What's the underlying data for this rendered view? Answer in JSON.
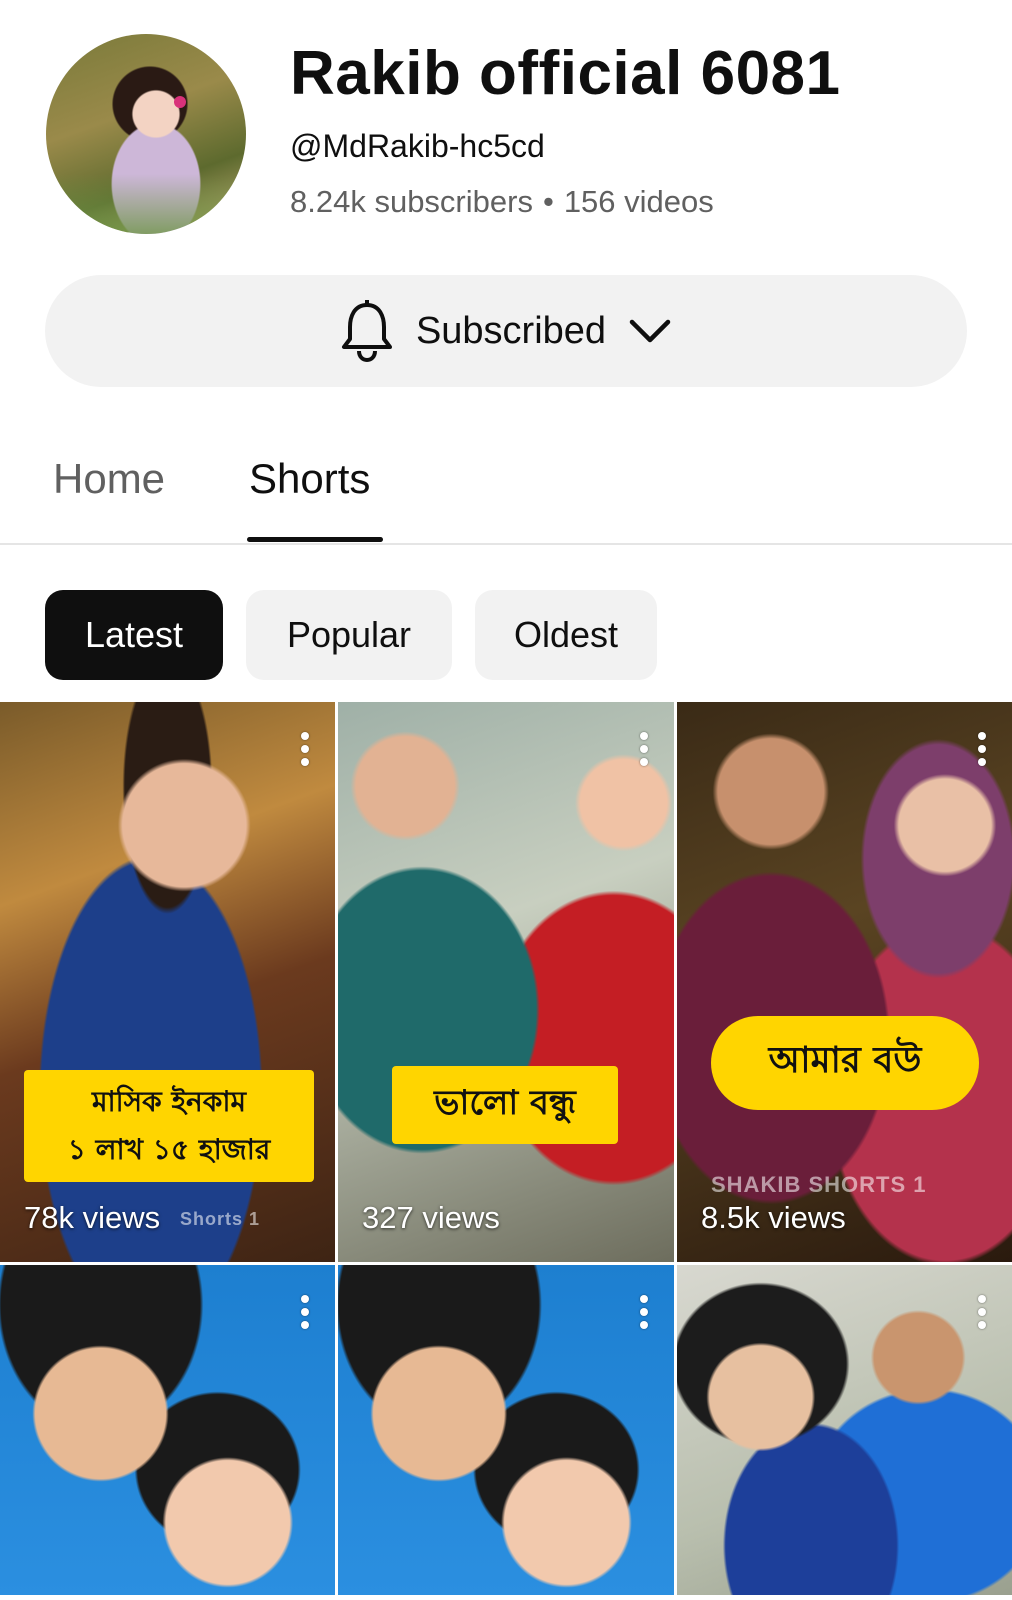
{
  "channel": {
    "name": "Rakib official 6081",
    "handle": "@MdRakib-hc5cd",
    "subscribers": "8.24k subscribers",
    "separator": "•",
    "videos": "156 videos"
  },
  "subscribe_button": {
    "label": "Subscribed",
    "icon": "bell-icon",
    "trailing_icon": "chevron-down-icon"
  },
  "tabs": [
    {
      "label": "Home",
      "active": false
    },
    {
      "label": "Shorts",
      "active": true
    }
  ],
  "filters": [
    {
      "label": "Latest",
      "selected": true
    },
    {
      "label": "Popular",
      "selected": false
    },
    {
      "label": "Oldest",
      "selected": false
    }
  ],
  "shorts": [
    {
      "views": "78k views",
      "caption_lines": [
        "মাসিক ইনকাম",
        "১ লাখ ১৫ হাজার"
      ],
      "watermark": "Shorts 1"
    },
    {
      "views": "327 views",
      "caption_lines": [
        "ভালো বন্ধু"
      ]
    },
    {
      "views": "8.5k views",
      "caption_lines": [
        "আমার বউ"
      ],
      "watermark": "SHAKIB SHORTS 1"
    },
    {
      "views": ""
    },
    {
      "views": ""
    },
    {
      "views": ""
    }
  ],
  "colors": {
    "accent_yellow": "#ffd500",
    "chip_selected": "#0f0f0f",
    "chip_bg": "#f2f2f2",
    "secondary_text": "#606060"
  }
}
